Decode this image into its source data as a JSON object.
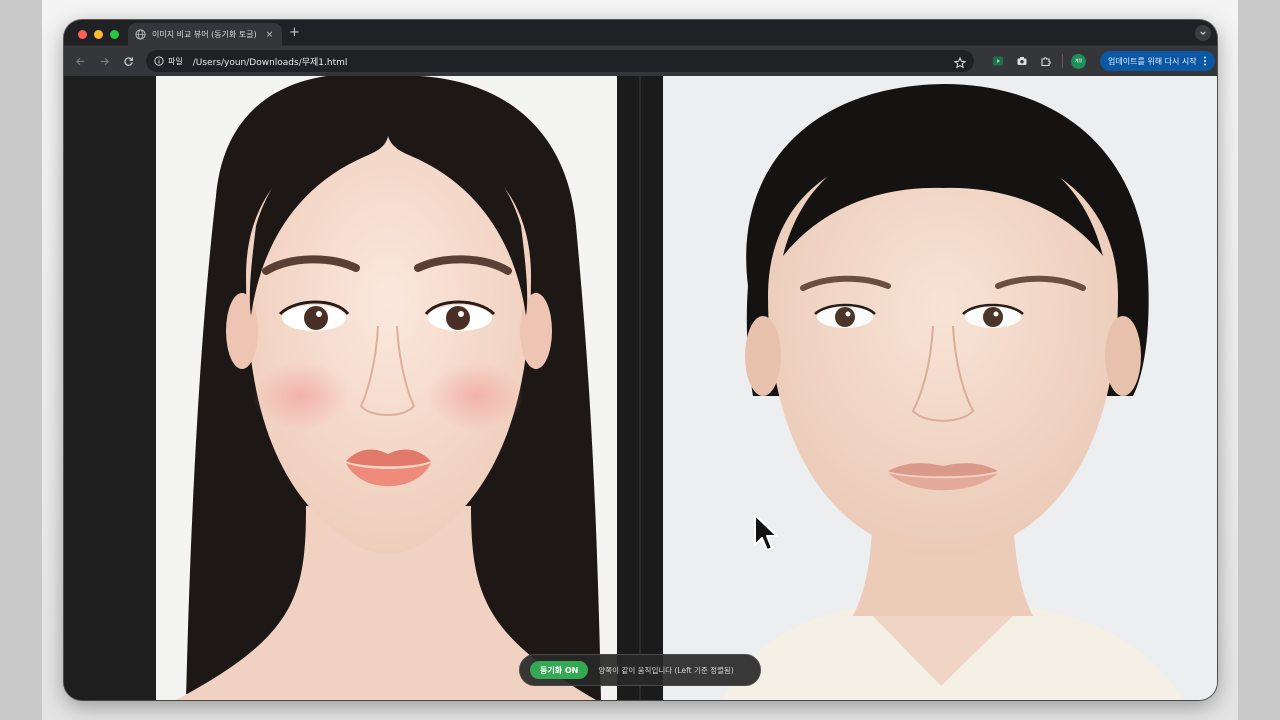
{
  "tab": {
    "title": "이미지 비교 뷰어 (동기화 토글)",
    "close_glyph": "×",
    "favicon": "globe-icon"
  },
  "new_tab_glyph": "+",
  "toolbar": {
    "site_label": "파일",
    "url": "/Users/youn/Downloads/무제1.html",
    "profile_label": "계정",
    "update_label": "업데이트를 위해 다시 시작"
  },
  "viewer": {
    "left_image": "portrait-left",
    "right_image": "portrait-right"
  },
  "sync": {
    "toggle_label": "동기화 ON",
    "status_text": "양쪽이 같이 움직입니다 (Left 기준 정렬됨)"
  },
  "colors": {
    "sync_on": "#34a853",
    "update_button": "#0b57a4",
    "window_chrome": "#35363a"
  }
}
